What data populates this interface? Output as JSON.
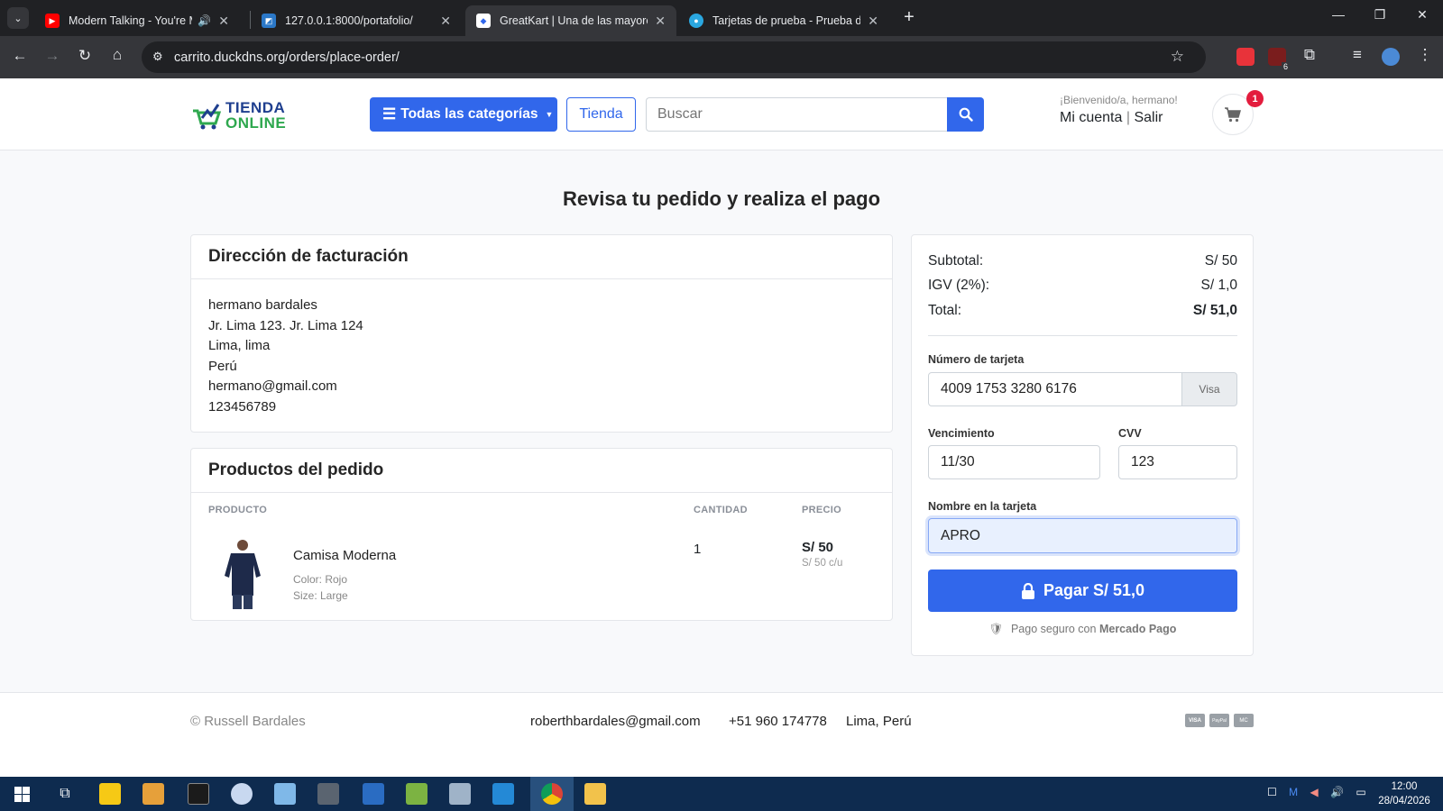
{
  "browser": {
    "tabs": [
      {
        "title": "Modern Talking - You're My",
        "icon": "youtube-icon",
        "audio": true
      },
      {
        "title": "127.0.0.1:8000/portafolio/",
        "icon": "page-icon"
      },
      {
        "title": "GreatKart | Una de las mayores",
        "icon": "greatkart-icon",
        "active": true
      },
      {
        "title": "Tarjetas de prueba - Prueba de",
        "icon": "mercadopago-icon"
      }
    ],
    "url": "carrito.duckdns.org/orders/place-order/",
    "extension_badge": "6"
  },
  "header": {
    "logo_line1": "TIENDA",
    "logo_line2": "ONLINE",
    "categories_label": "Todas las categorías",
    "store_label": "Tienda",
    "search_placeholder": "Buscar",
    "welcome": "¡Bienvenido/a, hermano!",
    "account_link": "Mi cuenta",
    "separator": "|",
    "logout_link": "Salir",
    "cart_count": "1"
  },
  "page": {
    "title": "Revisa tu pedido y realiza el pago"
  },
  "billing": {
    "heading": "Dirección de facturación",
    "name": "hermano bardales",
    "address": "Jr. Lima 123. Jr. Lima 124",
    "city": "Lima, lima",
    "country": "Perú",
    "email": "hermano@gmail.com",
    "phone": "123456789"
  },
  "products": {
    "heading": "Productos del pedido",
    "columns": [
      "PRODUCTO",
      "CANTIDAD",
      "PRECIO"
    ],
    "items": [
      {
        "name": "Camisa Moderna",
        "color": "Color: Rojo",
        "size": "Size: Large",
        "quantity": "1",
        "price": "S/ 50",
        "unit_price": "S/ 50 c/u"
      }
    ]
  },
  "summary": {
    "subtotal_label": "Subtotal:",
    "subtotal_value": "S/ 50",
    "tax_label": "IGV (2%):",
    "tax_value": "S/ 1,0",
    "total_label": "Total:",
    "total_value": "S/ 51,0"
  },
  "payment": {
    "card_number_label": "Número de tarjeta",
    "card_number": "4009 1753 3280 6176",
    "card_brand": "Visa",
    "expiry_label": "Vencimiento",
    "expiry": "11/30",
    "cvv_label": "CVV",
    "cvv": "123",
    "name_label": "Nombre en la tarjeta",
    "name": "APRO",
    "pay_button": "Pagar S/ 51,0",
    "secure_prefix": "Pago seguro con",
    "secure_brand": "Mercado Pago"
  },
  "footer": {
    "copyright": "© Russell Bardales",
    "email": "roberthbardales@gmail.com",
    "phone": "+51 960 174778",
    "location": "Lima, Perú",
    "payment_icons": [
      "visa-icon",
      "paypal-icon",
      "mastercard-icon"
    ],
    "payment_icon_labels": [
      "VISA",
      "PayPal",
      "MC"
    ]
  },
  "taskbar": {
    "time": "12:00",
    "date": "28/04/2026"
  },
  "colors": {
    "primary": "#3167eb",
    "badge": "#e31c3d",
    "logo_blue": "#1f3f8f",
    "logo_green": "#2fa84f"
  }
}
